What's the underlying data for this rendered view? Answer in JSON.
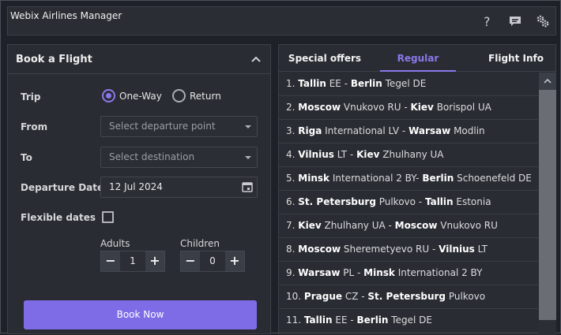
{
  "header": {
    "title": "Webix Airlines Manager",
    "icons": [
      "help-icon",
      "chat-icon",
      "settings-icon"
    ]
  },
  "booking": {
    "title": "Book a Flight",
    "trip_label": "Trip",
    "trip_options": [
      "One-Way",
      "Return"
    ],
    "trip_selected": "One-Way",
    "from_label": "From",
    "from_placeholder": "Select departure point",
    "to_label": "To",
    "to_placeholder": "Select destination",
    "date_label": "Departure Date",
    "date_value": "12 Jul 2024",
    "flexible_label": "Flexible dates",
    "flexible_checked": false,
    "adults_label": "Adults",
    "adults_value": "1",
    "children_label": "Children",
    "children_value": "0",
    "book_label": "Book Now"
  },
  "offers": {
    "tabs": [
      "Special offers",
      "Regular",
      "Flight Info"
    ],
    "active_tab": "Regular",
    "rows": [
      {
        "num": "1.",
        "from": "Tallin",
        "from_rest": " EE - ",
        "to": "Berlin",
        "to_rest": " Tegel DE"
      },
      {
        "num": "2.",
        "from": "Moscow",
        "from_rest": " Vnukovo RU - ",
        "to": "Kiev",
        "to_rest": " Borispol UA"
      },
      {
        "num": "3.",
        "from": "Riga",
        "from_rest": " International LV - ",
        "to": "Warsaw",
        "to_rest": " Modlin"
      },
      {
        "num": "4.",
        "from": "Vilnius",
        "from_rest": " LT - ",
        "to": "Kiev",
        "to_rest": " Zhulhany UA"
      },
      {
        "num": "5.",
        "from": "Minsk",
        "from_rest": " International 2 BY- ",
        "to": "Berlin",
        "to_rest": " Schoenefeld DE"
      },
      {
        "num": "6.",
        "from": "St. Petersburg",
        "from_rest": " Pulkovo - ",
        "to": "Tallin",
        "to_rest": " Estonia"
      },
      {
        "num": "7.",
        "from": "Kiev",
        "from_rest": " Zhulhany UA - ",
        "to": "Moscow",
        "to_rest": " Vnukovo RU"
      },
      {
        "num": "8.",
        "from": "Moscow",
        "from_rest": " Sheremetyevo RU - ",
        "to": "Vilnius",
        "to_rest": " LT"
      },
      {
        "num": "9.",
        "from": "Warsaw",
        "from_rest": " PL - ",
        "to": "Minsk",
        "to_rest": " International 2 BY"
      },
      {
        "num": "10.",
        "from": "Prague",
        "from_rest": " CZ - ",
        "to": "St. Petersburg",
        "to_rest": " Pulkovo"
      },
      {
        "num": "11.",
        "from": "Tallin",
        "from_rest": " EE - ",
        "to": "Berlin",
        "to_rest": " Tegel DE"
      }
    ]
  },
  "colors": {
    "accent": "#8a78ea",
    "button": "#7e6ce6",
    "background": "#1e2127",
    "panel": "#292c32"
  }
}
